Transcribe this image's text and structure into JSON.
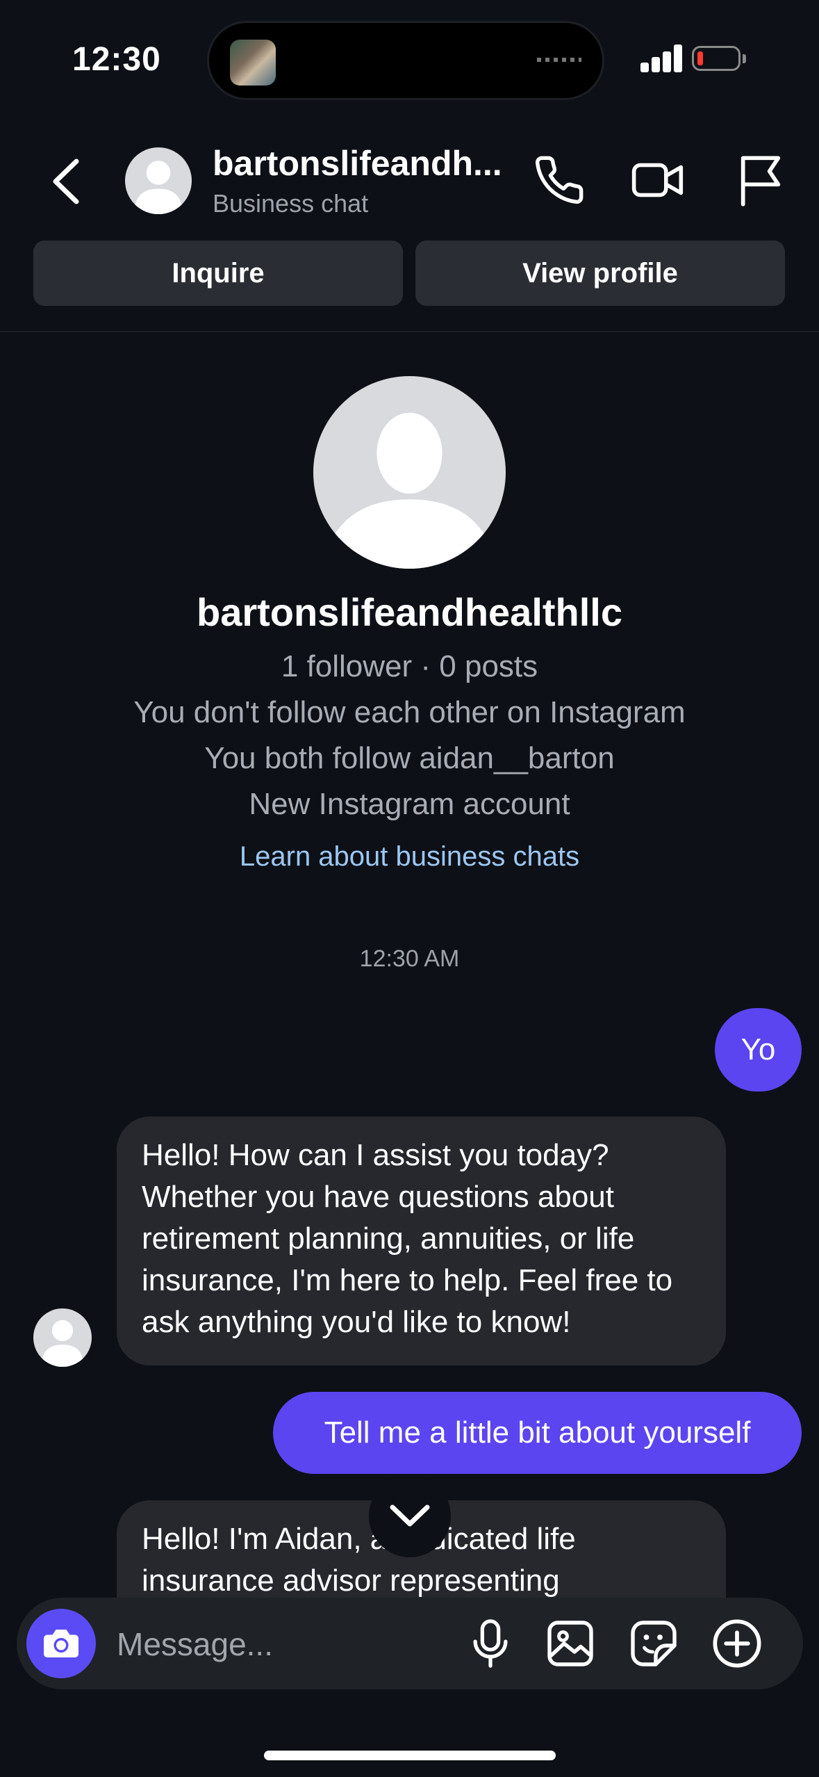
{
  "status_bar": {
    "time": "12:30"
  },
  "header": {
    "name": "bartonslifeandh...",
    "subtitle": "Business chat",
    "actions": [
      "back-icon",
      "phone-icon",
      "video-icon",
      "flag-icon"
    ]
  },
  "buttons": {
    "inquire": "Inquire",
    "view_profile": "View profile"
  },
  "profile": {
    "username": "bartonslifeandhealthllc",
    "stats": "1 follower · 0 posts",
    "follow_status": "You don't follow each other on Instagram",
    "mutual": "You both follow aidan__barton",
    "account_age": "New Instagram account",
    "learn_link": "Learn about business chats"
  },
  "chat": {
    "timestamp": "12:30 AM",
    "messages": [
      {
        "from": "me",
        "text": "Yo"
      },
      {
        "from": "them",
        "text": "Hello! How can I assist you today? Whether you have questions about retirement planning, annuities, or life insurance, I'm here to help. Feel free to ask anything you'd like to know!"
      },
      {
        "from": "me",
        "text": "Tell me a little bit about yourself"
      },
      {
        "from": "them",
        "text": "Hello! I'm Aidan, a dedicated life insurance advisor representing"
      }
    ]
  },
  "composer": {
    "placeholder": "Message...",
    "icons": [
      "camera-icon",
      "microphone-icon",
      "gallery-icon",
      "sticker-icon",
      "plus-icon"
    ]
  },
  "colors": {
    "background": "#0d1016",
    "outgoing_bubble": "#5b45f0",
    "incoming_bubble": "#26282e",
    "link": "#9cc7f2"
  }
}
